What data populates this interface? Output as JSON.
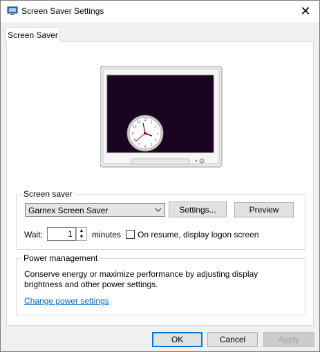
{
  "window": {
    "title": "Screen Saver Settings",
    "close_glyph": "✕"
  },
  "tabs": [
    {
      "label": "Screen Saver"
    }
  ],
  "screen_saver_group": {
    "label": "Screen saver",
    "selected": "Garnex Screen Saver",
    "settings_button": "Settings...",
    "preview_button": "Preview",
    "wait_label": "Wait:",
    "wait_value": "1",
    "minutes_label": "minutes",
    "logon_checkbox_label": "On resume, display logon screen",
    "logon_checked": false
  },
  "power_group": {
    "label": "Power management",
    "description": "Conserve energy or maximize performance by adjusting display brightness and other power settings.",
    "link": "Change power settings"
  },
  "footer": {
    "ok": "OK",
    "cancel": "Cancel",
    "apply": "Apply"
  },
  "colors": {
    "accent": "#0078d7",
    "link": "#0066cc",
    "screen_bg": "#1a0420"
  },
  "icons": [
    "monitor-settings-icon",
    "close-icon",
    "chevron-down-icon",
    "spin-up-icon",
    "spin-down-icon"
  ]
}
